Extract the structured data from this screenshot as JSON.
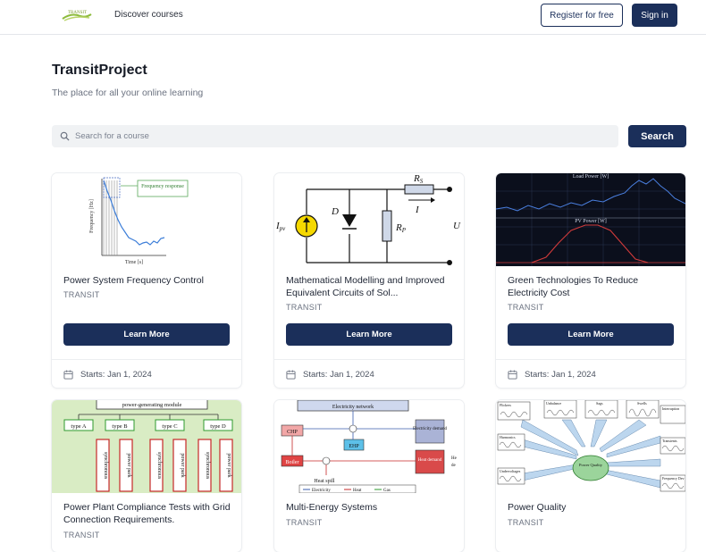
{
  "header": {
    "logo_text": "TRANSIT",
    "nav_link": "Discover courses",
    "register_label": "Register for free",
    "signin_label": "Sign in"
  },
  "hero": {
    "title": "TransitProject",
    "subtitle": "The place for all your online learning"
  },
  "search": {
    "placeholder": "Search for a course",
    "button_label": "Search"
  },
  "courses": [
    {
      "title": "Power System Frequency Control",
      "org": "TRANSIT",
      "button": "Learn More",
      "start": "Starts: Jan 1, 2024"
    },
    {
      "title": "Mathematical Modelling and Improved Equivalent Circuits of Sol...",
      "org": "TRANSIT",
      "button": "Learn More",
      "start": "Starts: Jan 1, 2024"
    },
    {
      "title": "Green Technologies To Reduce Electricity Cost",
      "org": "TRANSIT",
      "button": "Learn More",
      "start": "Starts: Jan 1, 2024"
    },
    {
      "title": "Power Plant Compliance Tests with Grid Connection Requirements.",
      "org": "TRANSIT"
    },
    {
      "title": "Multi-Energy Systems",
      "org": "TRANSIT"
    },
    {
      "title": "Power Quality",
      "org": "TRANSIT"
    }
  ],
  "thumbnails": {
    "freq": {
      "annotation": "Frequency response",
      "ylabel": "Frequency [Hz]",
      "xlabel": "Time [s]"
    },
    "circuit": {
      "ipv": "I",
      "ipv_sub": "pv",
      "d": "D",
      "rs": "R",
      "rs_sub": "S",
      "i": "I",
      "rp": "R",
      "rp_sub": "P",
      "u": "U"
    },
    "power": {
      "top_label": "Load Power [W]",
      "mid_label": "PV Power [W]"
    },
    "compliance": {
      "header": "power-generating module",
      "types": [
        "type A",
        "type B",
        "type C",
        "type D"
      ],
      "sync": "synchronous",
      "park": "power park"
    },
    "multi": {
      "network": "Electricity network",
      "chp": "CHP",
      "boiler": "Boiler",
      "ehp": "EHP",
      "elec_demand": "Electricity demand",
      "heat_demand": "Heat demand",
      "he": "He",
      "de": "de",
      "heat_spill": "Heat spill",
      "legend_elec": "Electricity",
      "legend_heat": "Heat",
      "legend_gas": "Gas"
    },
    "quality": {
      "center": "Power Quality",
      "labels": [
        "Flickers",
        "Unbalance",
        "Sags",
        "Swells",
        "Interruption",
        "Harmonics",
        "Transients",
        "Undervoltages",
        "Frequency Dev"
      ]
    }
  },
  "colors": {
    "primary": "#1b2f5a",
    "search_bg": "#f0f2f4"
  }
}
